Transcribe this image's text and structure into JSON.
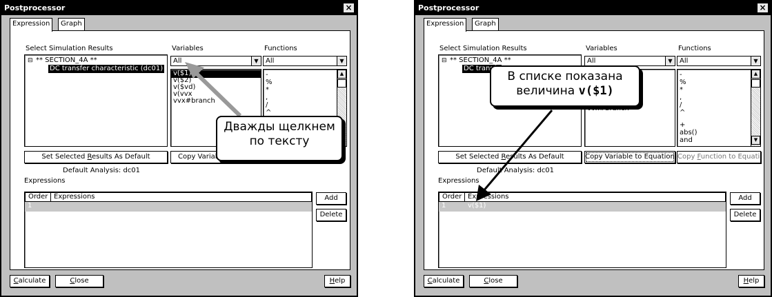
{
  "left": {
    "title": "Postprocessor",
    "close_glyph": "×",
    "tabs": [
      "Expression",
      "Graph"
    ],
    "select_results_label": "Select Simulation Results",
    "tree": {
      "root": "** SECTION_4A **",
      "child": "DC transfer characteristic (dc01)"
    },
    "variables_label": "Variables",
    "variables_filter": "All",
    "variables": [
      "v($1)",
      "v($2)",
      "v($vd)",
      "v(vvx",
      "vvx#branch"
    ],
    "functions_label": "Functions",
    "functions_filter": "All",
    "functions": [
      "-",
      "%",
      "*",
      ",",
      "/",
      "^"
    ],
    "set_default_pre": "Set Selected ",
    "set_default_u": "R",
    "set_default_post": "esults As Default",
    "copy_var_button": "Copy Variab",
    "default_analysis": "Default Analysis: dc01",
    "expressions_label": "Expressions",
    "grid_order": "Order",
    "grid_expr": "Expressions",
    "grid_row_num": "1",
    "grid_row_expr": "",
    "add": "Add",
    "delete": "Delete",
    "calculate_u": "C",
    "calculate_rest": "alculate",
    "close_u": "C",
    "close_rest": "lose",
    "help_u": "H",
    "help_rest": "elp",
    "callout_line1": "Дважды щелкнем",
    "callout_line2": "по тексту"
  },
  "right": {
    "title": "Postprocessor",
    "close_glyph": "×",
    "tabs": [
      "Expression",
      "Graph"
    ],
    "select_results_label": "Select Simulation Results",
    "tree": {
      "root": "** SECTION_4A **",
      "child": "DC transfe"
    },
    "variables_label": "Variables",
    "variables_filter": "All",
    "variables_visible": "vvx#branch",
    "functions_label": "Functions",
    "functions_filter": "All",
    "functions": [
      "-",
      "%",
      "*",
      ",",
      "/",
      "^",
      "+",
      "abs()",
      "and"
    ],
    "set_default_pre": "Set Selected ",
    "set_default_u": "R",
    "set_default_post": "esults As Default",
    "copy_var_button": "Copy Variable to Equation",
    "copy_func_pre": "Copy ",
    "copy_func_u": "F",
    "copy_func_post": "unction to Equation",
    "default_analysis": "Default Analysis: dc01",
    "expressions_label": "Expressions",
    "grid_order": "Order",
    "grid_expr": "Expressions",
    "grid_row_num": "1",
    "grid_row_expr": "v($1)",
    "add": "Add",
    "delete": "Delete",
    "calculate_u": "C",
    "calculate_rest": "alculate",
    "close_u": "C",
    "close_rest": "lose",
    "help_u": "H",
    "help_rest": "elp",
    "callout_line1": "В списке показана",
    "callout_line2_pre": "величина ",
    "callout_line2_bold": "v($1)"
  }
}
